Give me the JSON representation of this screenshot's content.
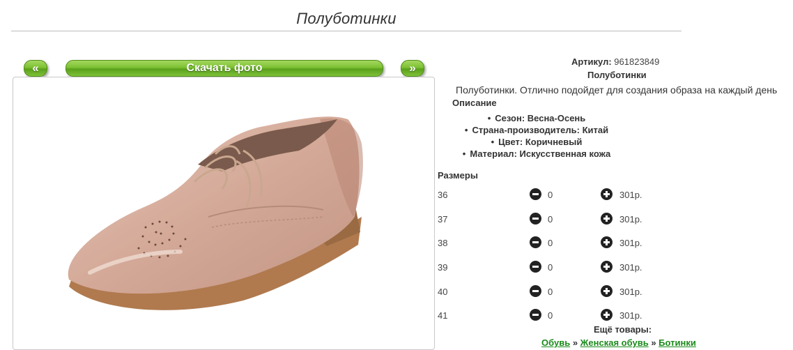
{
  "page": {
    "title": "Полуботинки"
  },
  "gallery": {
    "prev_label": "«",
    "next_label": "»",
    "download_label": "Скачать фото"
  },
  "product": {
    "article_label": "Артикул:",
    "article_value": "961823849",
    "name": "Полуботинки",
    "description": "Полуботинки. Отлично подойдет для создания образа на каждый день",
    "description_heading": "Описание",
    "attributes": [
      "Сезон: Весна-Осень",
      "Страна-производитель: Китай",
      "Цвет: Коричневый",
      "Материал: Искусственная кожа"
    ]
  },
  "sizes": {
    "heading": "Размеры",
    "rows": [
      {
        "size": "36",
        "qty": "0",
        "price": "301р."
      },
      {
        "size": "37",
        "qty": "0",
        "price": "301р."
      },
      {
        "size": "38",
        "qty": "0",
        "price": "301р."
      },
      {
        "size": "39",
        "qty": "0",
        "price": "301р."
      },
      {
        "size": "40",
        "qty": "0",
        "price": "301р."
      },
      {
        "size": "41",
        "qty": "0",
        "price": "301р."
      }
    ]
  },
  "more": {
    "heading": "Ещё товары:",
    "breadcrumbs": [
      "Обувь",
      "Женская обувь",
      "Ботинки"
    ],
    "separator": "»"
  },
  "colors": {
    "accent_green": "#7cc033",
    "link_green": "#1a8a1a",
    "shoe": "#d9b2a3"
  }
}
